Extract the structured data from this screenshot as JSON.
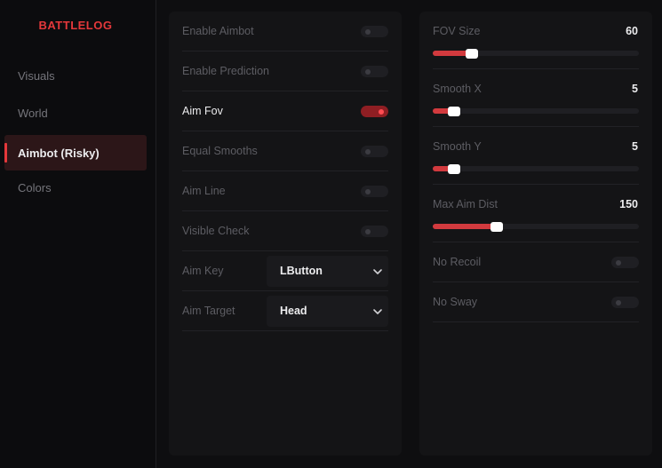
{
  "brand": "BATTLELOG",
  "nav": [
    {
      "label": "Visuals",
      "active": false
    },
    {
      "label": "World",
      "active": false
    },
    {
      "label": "Aimbot (Risky)",
      "active": true
    },
    {
      "label": "Colors",
      "active": false
    }
  ],
  "left_panel": {
    "toggles": [
      {
        "label": "Enable Aimbot",
        "on": false
      },
      {
        "label": "Enable Prediction",
        "on": false
      },
      {
        "label": "Aim Fov",
        "on": true
      },
      {
        "label": "Equal Smooths",
        "on": false
      },
      {
        "label": "Aim Line",
        "on": false
      },
      {
        "label": "Visible Check",
        "on": false
      }
    ],
    "selects": [
      {
        "label": "Aim Key",
        "value": "LButton",
        "icon": "chevron-down-icon"
      },
      {
        "label": "Aim Target",
        "value": "Head",
        "icon": "chevron-down-icon"
      }
    ]
  },
  "right_panel": {
    "sliders": [
      {
        "label": "FOV Size",
        "value": "60",
        "level": 0.19
      },
      {
        "label": "Smooth X",
        "value": "5",
        "level": 0.105
      },
      {
        "label": "Smooth Y",
        "value": "5",
        "level": 0.105
      },
      {
        "label": "Max Aim Dist",
        "value": "150",
        "level": 0.31
      }
    ],
    "toggles": [
      {
        "label": "No Recoil",
        "on": false
      },
      {
        "label": "No Sway",
        "on": false
      }
    ]
  },
  "colors": {
    "accent": "#e5383b",
    "background": "#0e0e10",
    "panel": "#141416",
    "active_nav": "#2c1618"
  }
}
